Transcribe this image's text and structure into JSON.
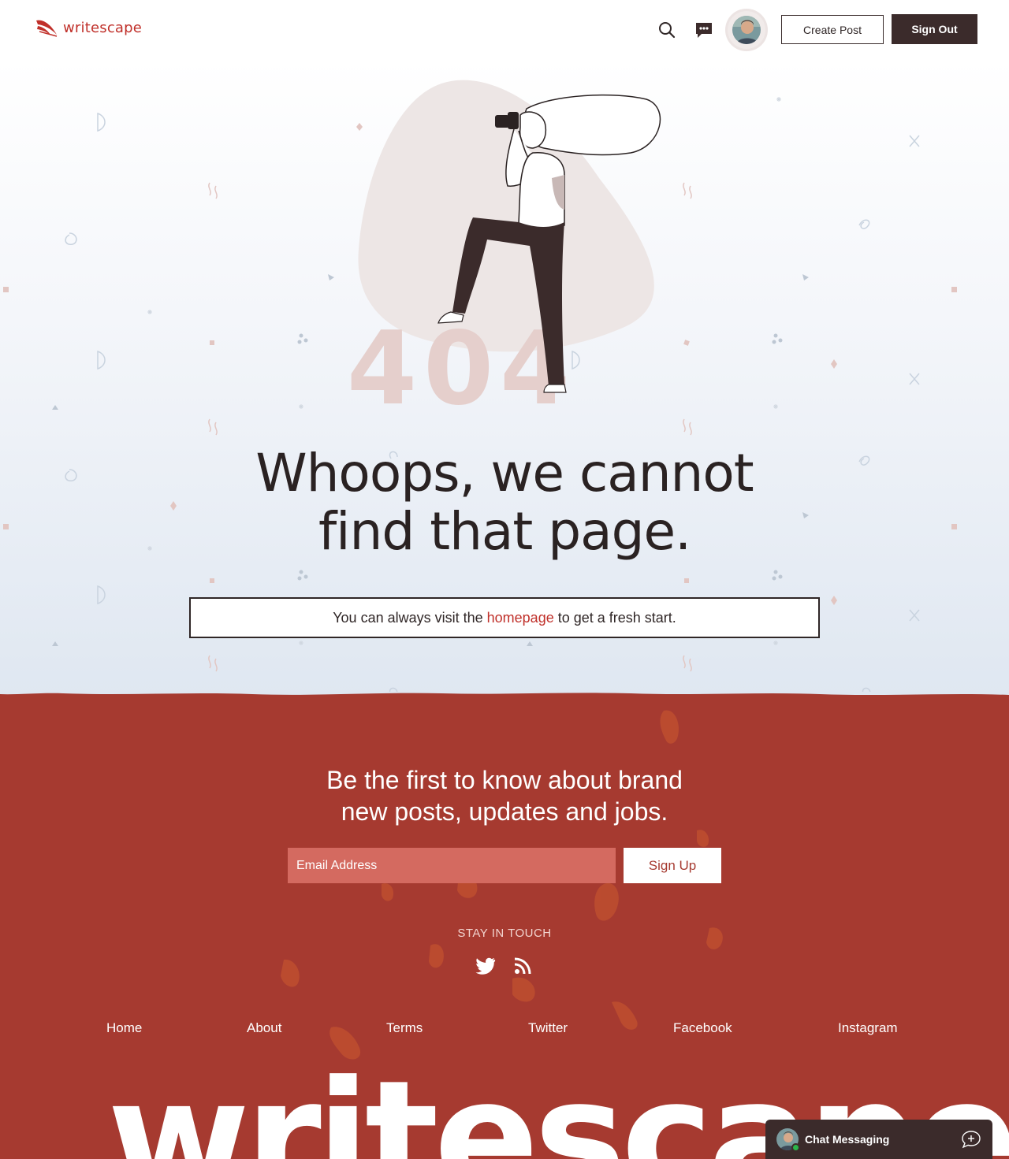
{
  "header": {
    "logo_text": "writescape",
    "create_post_label": "Create Post",
    "sign_out_label": "Sign Out",
    "icons": [
      "search-icon",
      "chat-bubble-icon",
      "avatar"
    ]
  },
  "hero": {
    "error_code": "404",
    "heading_line1": "Whoops, we cannot",
    "heading_line2": "find that page.",
    "notice_before": "You can always visit the",
    "notice_link": "homepage",
    "notice_after": "to get a fresh start."
  },
  "footer": {
    "newsletter_line1": "Be the first to know about brand",
    "newsletter_line2": "new posts, updates and jobs.",
    "email_placeholder": "Email Address",
    "signup_label": "Sign Up",
    "stay_in_touch": "STAY IN TOUCH",
    "social_icons": [
      "twitter-icon",
      "rss-icon"
    ],
    "nav": [
      "Home",
      "About",
      "Terms",
      "Twitter",
      "Facebook",
      "Instagram"
    ],
    "wordmark": "writescape"
  },
  "chat": {
    "label": "Chat Messaging"
  },
  "colors": {
    "brand_red": "#c0302a",
    "footer_bg": "#a63a30",
    "dark": "#3b2b2b",
    "input_bg": "#d46a60",
    "error_code": "#e5cfcc"
  }
}
